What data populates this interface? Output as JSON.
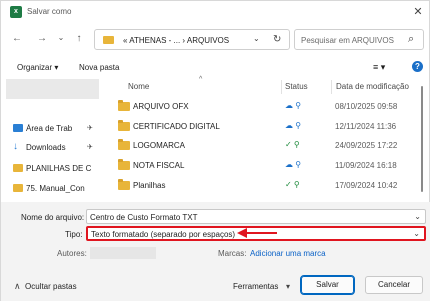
{
  "window": {
    "title": "Salvar como",
    "app_icon_letter": "x",
    "close_glyph": "✕"
  },
  "nav": {
    "back_glyph": "←",
    "forward_glyph": "→",
    "dropdown_glyph": "⌄",
    "up_glyph": "↑",
    "address_text": "« ATHENAS - ...  ›  ARQUIVOS",
    "address_chevron": "⌄",
    "refresh_glyph": "↻",
    "search_placeholder": "Pesquisar em ARQUIVOS",
    "search_glyph": "⌕"
  },
  "toolbar": {
    "organize_label": "Organizar ▾",
    "new_folder_label": "Nova pasta",
    "view_label": "≡ ▾",
    "help_label": "?"
  },
  "sidebar": {
    "items": [
      {
        "label": "Área de Trab",
        "icon": "desktop-icon",
        "pinned": true
      },
      {
        "label": "Downloads",
        "icon": "download-icon",
        "pinned": true
      },
      {
        "label": "PLANILHAS DE C",
        "icon": "folder-icon",
        "pinned": false
      },
      {
        "label": "75. Manual_Con",
        "icon": "folder-icon",
        "pinned": false
      }
    ],
    "pin_glyph": "✈"
  },
  "list": {
    "sort_glyph": "^",
    "columns": {
      "name": "Nome",
      "status": "Status",
      "date": "Data de modificação"
    },
    "rows": [
      {
        "name": "ARQUIVO OFX",
        "status": "☁ ⚲",
        "date": "08/10/2025 09:58"
      },
      {
        "name": "CERTIFICADO DIGITAL",
        "status": "☁ ⚲",
        "date": "12/11/2024 11:36"
      },
      {
        "name": "LOGOMARCA",
        "status": "✓ ⚲",
        "date": "24/09/2025 17:22"
      },
      {
        "name": "NOTA FISCAL",
        "status": "☁ ⚲",
        "date": "11/09/2024 16:18"
      },
      {
        "name": "Planilhas",
        "status": "✓ ⚲",
        "date": "17/09/2024 10:42"
      }
    ],
    "colors": {
      "cloud": "#1a6fc8",
      "synced": "#1e8a3c"
    }
  },
  "form": {
    "filename_label": "Nome do arquivo:",
    "filename_value": "Centro de Custo Formato TXT",
    "type_label": "Tipo:",
    "type_value": "Texto formatado (separado por espaços)",
    "authors_label": "Autores:",
    "tags_label": "Marcas:",
    "tags_link": "Adicionar uma marca",
    "chevron": "⌄"
  },
  "footer": {
    "hide_folders_label": "Ocultar pastas",
    "hide_glyph": "∧",
    "tools_label": "Ferramentas",
    "tools_glyph": "▾",
    "save_label": "Salvar",
    "cancel_label": "Cancelar"
  },
  "annotation": {
    "highlight_color": "#e0151f"
  }
}
